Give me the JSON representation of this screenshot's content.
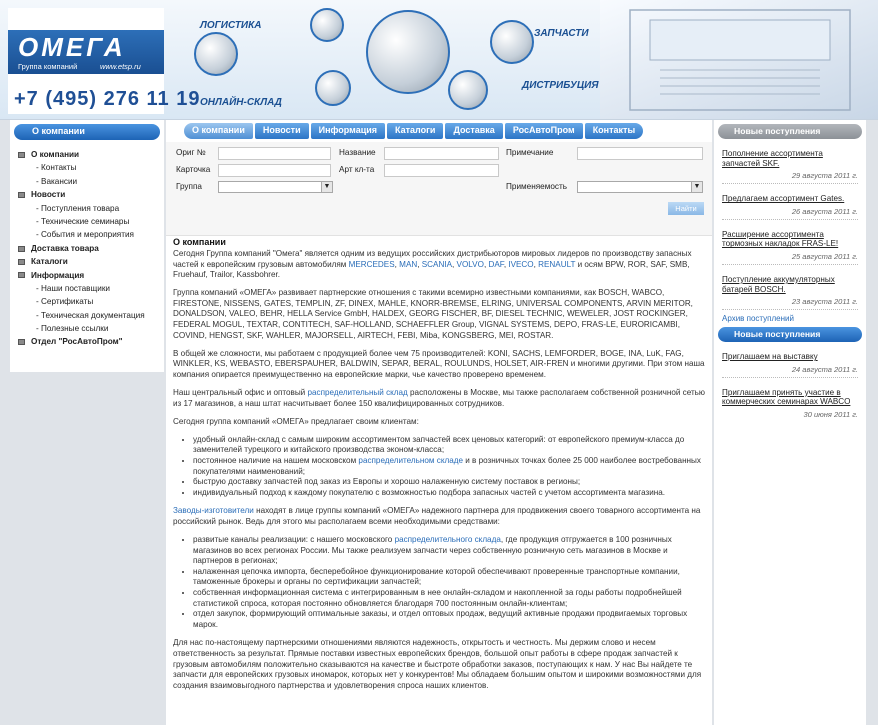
{
  "header": {
    "logo": "ОМЕГА",
    "logo_sub": "Группа компаний",
    "logo_url": "www.etsp.ru",
    "phone": "+7 (495) 276 11 19",
    "labels": {
      "logistics": "ЛОГИСТИКА",
      "warehouse": "ОНЛАЙН-СКЛАД",
      "parts": "ЗАПЧАСТИ",
      "distribution": "ДИСТРИБУЦИЯ"
    }
  },
  "left": {
    "title": "О компании",
    "items": [
      {
        "label": "О компании",
        "level": "top"
      },
      {
        "label": "- Контакты",
        "level": "sub"
      },
      {
        "label": "- Вакансии",
        "level": "sub"
      },
      {
        "label": "Новости",
        "level": "top"
      },
      {
        "label": "- Поступления товара",
        "level": "sub"
      },
      {
        "label": "- Технические семинары",
        "level": "sub"
      },
      {
        "label": "- События и мероприятия",
        "level": "sub"
      },
      {
        "label": "Доставка товара",
        "level": "top"
      },
      {
        "label": "Каталоги",
        "level": "top"
      },
      {
        "label": "Информация",
        "level": "top"
      },
      {
        "label": "- Наши поставщики",
        "level": "sub"
      },
      {
        "label": "- Сертификаты",
        "level": "sub"
      },
      {
        "label": "- Техническая документация",
        "level": "sub"
      },
      {
        "label": "- Полезные ссылки",
        "level": "sub"
      },
      {
        "label": "Отдел \"РосАвтоПром\"",
        "level": "top"
      }
    ]
  },
  "nav": [
    "О компании",
    "Новости",
    "Информация",
    "Каталоги",
    "Доставка",
    "РосАвтоПром",
    "Контакты"
  ],
  "search": {
    "orig": "Ориг №",
    "name": "Название",
    "note": "Примечание",
    "card": "Карточка",
    "art": "Арт кл-та",
    "group": "Группа",
    "group_value": "",
    "applic": "Применяемость",
    "applic_value": "",
    "button": "Найти"
  },
  "content": {
    "title": "О компании",
    "p1_a": "Сегодня Группа компаний \"Омега\" является одним из ведущих российских дистрибьюторов мировых лидеров по производству запасных частей к европейским грузовым автомобилям ",
    "brands": [
      "MERCEDES",
      "MAN",
      "SCANIA",
      "VOLVO",
      "DAF",
      "IVECO",
      "RENAULT"
    ],
    "p1_b": " и осям BPW, ROR, SAF, SMB, Fruehauf, Trailor, Kassbohrer.",
    "p2": "Группа компаний «ОМЕГА» развивает партнерские отношения с такими всемирно известными компаниями, как BOSCH, WABCO, FIRESTONE, NISSENS, GATES, TEMPLIN, ZF, DINEX, MAHLE, KNORR-BREMSE, ELRING, UNIVERSAL COMPONENTS, ARVIN MERITOR, DONALDSON, VALEO, BEHR, HELLA Service GmbH, HALDEX, GEORG FISCHER, BF, DIESEL TECHNIC, WEWELER, JOST ROCKINGER, FEDERAL MOGUL, TEXTAR, CONTITECH, SAF-HOLLAND, SCHAEFFLER Group, VIGNAL SYSTEMS, DEPO, FRAS-LE, EURORICAMBI, COVIND, HENGST, SKF, WAHLER, MAJORSELL, AIRTECH, FEBI, Miba, KONGSBERG, MEI, ROSTAR.",
    "p3": "В общей же сложности, мы работаем с продукцией более чем 75 производителей: KONI, SACHS, LEMFORDER, BOGE, INA, LuK, FAG, WINKLER, KS, WEBASTO, EBERSPAUHER, BALDWIN, SEPAR, BERAL, ROULUNDS, HOLSET, AIR-FREN и многими другими. При этом наша компания опирается преимущественно на европейские марки, чье качество проверено временем.",
    "p4_a": "Наш центральный офис и оптовый ",
    "p4_link": "распределительный склад",
    "p4_b": " расположены в Москве, мы также располагаем собственной розничной сетью из 17 магазинов, а наш штат насчитывает более 150 квалифицированных сотрудников.",
    "p5": "Сегодня группа компаний «ОМЕГА» предлагает своим клиентам:",
    "list1": [
      "удобный онлайн-склад с самым широким ассортиментом запчастей всех ценовых категорий: от европейского премиум-класса до заменителей турецкого и китайского производства эконом-класса;",
      "быструю доставку запчастей под заказ из Европы и хорошо налаженную систему поставок в регионы;",
      "индивидуальный подход к каждому покупателю с возможностью подбора запасных частей с учетом ассортимента магазина."
    ],
    "l1b_a": "постоянное наличие на нашем московском ",
    "l1b_link": "распределительном складе",
    "l1b_b": " и в розничных точках более 25 000 наиболее востребованных покупателями наименований;",
    "p6_link": "Заводы-изготовители",
    "p6_b": " находят в лице группы компаний «ОМЕГА» надежного партнера для продвижения своего товарного ассортимента на российский рынок. Ведь для этого мы располагаем всеми необходимыми средствами:",
    "l2a_a": "развитые каналы реализации: с нашего московского ",
    "l2a_link": "распределительного склада",
    "l2a_b": ", где продукция отгружается в 100 розничных магазинов во всех регионах России. Мы также реализуем запчасти через собственную розничную сеть магазинов в Москве и партнеров в регионах;",
    "list2": [
      "налаженная цепочка импорта, бесперебойное функционирование которой обеспечивают проверенные транспортные компании, таможенные брокеры и органы по сертификации запчастей;",
      "собственная информационная система с интегрированным в нее онлайн-складом и накопленной за годы работы подробнейшей статистикой спроса, которая постоянно обновляется благодаря 700 постоянным онлайн-клиентам;",
      "отдел закупок, формирующий оптимальные заказы, и отдел оптовых продаж, ведущий активные продажи продвигаемых торговых марок."
    ],
    "p7": "Для нас по-настоящему партнерскими отношениями являются надежность, открытость и честность. Мы держим слово и несем ответственность за результат. Прямые поставки известных европейских брендов, большой опыт работы в сфере продаж запчастей к грузовым автомобилям положительно сказываются на качестве и быстроте обработки заказов, поступающих к нам. У нас Вы найдете те запчасти для европейских грузовых иномарок, которых нет у конкурентов! Мы обладаем большим опытом и широкими возможностями для создания взаимовыгодного партнерства и удовлетворения спроса наших клиентов."
  },
  "right": {
    "new_title": "Новые поступления",
    "new": [
      {
        "t": "Пополнение ассортимента запчастей SKF.",
        "d": "29 августа 2011 г."
      },
      {
        "t": "Предлагаем ассортимент Gates.",
        "d": "26 августа 2011 г."
      },
      {
        "t": "Расширение ассортимента тормозных накладок FRAS-LE!",
        "d": "25 августа 2011 г."
      },
      {
        "t": "Поступление аккумуляторных батарей BOSCH.",
        "d": "23 августа 2011 г."
      }
    ],
    "archive": "Архив поступлений",
    "news_title": "Новые поступления",
    "news": [
      {
        "t": "Приглашаем на выставку",
        "d": "24 августа 2011 г."
      },
      {
        "t": "Приглашаем принять участие в коммерческих семинарах WABCO",
        "d": "30 июня 2011 г."
      }
    ]
  }
}
